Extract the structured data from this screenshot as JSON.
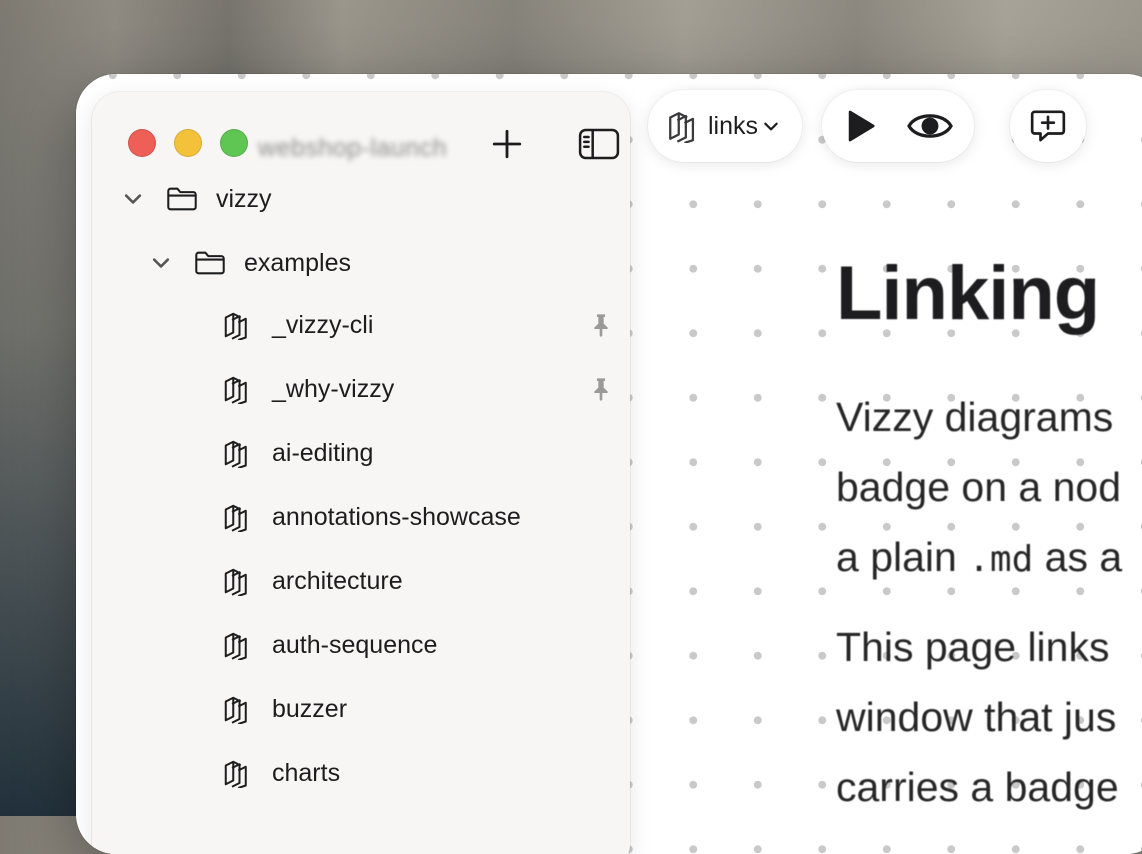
{
  "sidebar": {
    "workspace_title": "webshop-launch",
    "tree": {
      "root": {
        "label": "vizzy",
        "expanded": true
      },
      "folder": {
        "label": "examples",
        "expanded": true
      },
      "files": [
        {
          "label": "_vizzy-cli",
          "pinned": true
        },
        {
          "label": "_why-vizzy",
          "pinned": true
        },
        {
          "label": "ai-editing",
          "pinned": false
        },
        {
          "label": "annotations-showcase",
          "pinned": false
        },
        {
          "label": "architecture",
          "pinned": false
        },
        {
          "label": "auth-sequence",
          "pinned": false
        },
        {
          "label": "buzzer",
          "pinned": false
        },
        {
          "label": "charts",
          "pinned": false
        }
      ]
    }
  },
  "toolbar": {
    "diagram_selector": "links",
    "icons": [
      "vizzy-diagram-icon",
      "play-icon",
      "eye-icon",
      "add-comment-icon"
    ]
  },
  "document": {
    "heading": "Linking",
    "para1": {
      "line1": "Vizzy diagrams",
      "line2": "badge on a nod",
      "line3_pre": "a plain ",
      "line3_code": ".md",
      "line3_post": " as a"
    },
    "para2": {
      "line1": "This page links",
      "line2": "window that jus",
      "line3": "carries a badge"
    }
  },
  "colors": {
    "traffic_red": "#ee5f57",
    "traffic_yellow": "#f4c13b",
    "traffic_green": "#5fc653",
    "sidebar_bg": "#f7f6f4",
    "text": "#1d1d1f"
  }
}
